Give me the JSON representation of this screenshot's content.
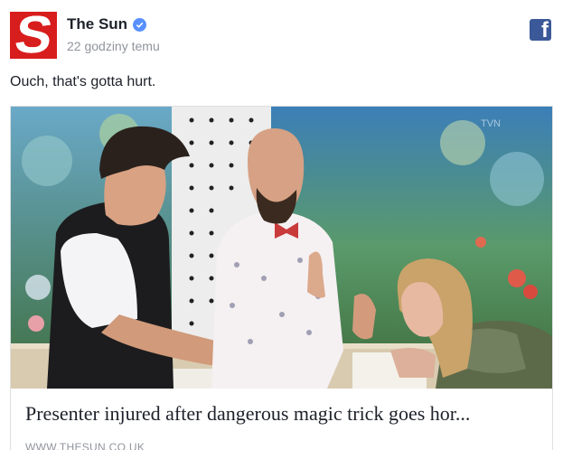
{
  "post": {
    "page_name": "The Sun",
    "logo_letter": "S",
    "timestamp": "22 godziny temu",
    "text": "Ouch, that's gotta hurt.",
    "brand_color": "#d81d1d",
    "verified_color": "#5890ff"
  },
  "share_icon": {
    "name": "facebook-icon",
    "glyph": "f",
    "color": "#3b5998"
  },
  "link_card": {
    "title": "Presenter injured after dangerous magic trick goes hor...",
    "domain": "WWW.THESUN.CO.UK"
  }
}
